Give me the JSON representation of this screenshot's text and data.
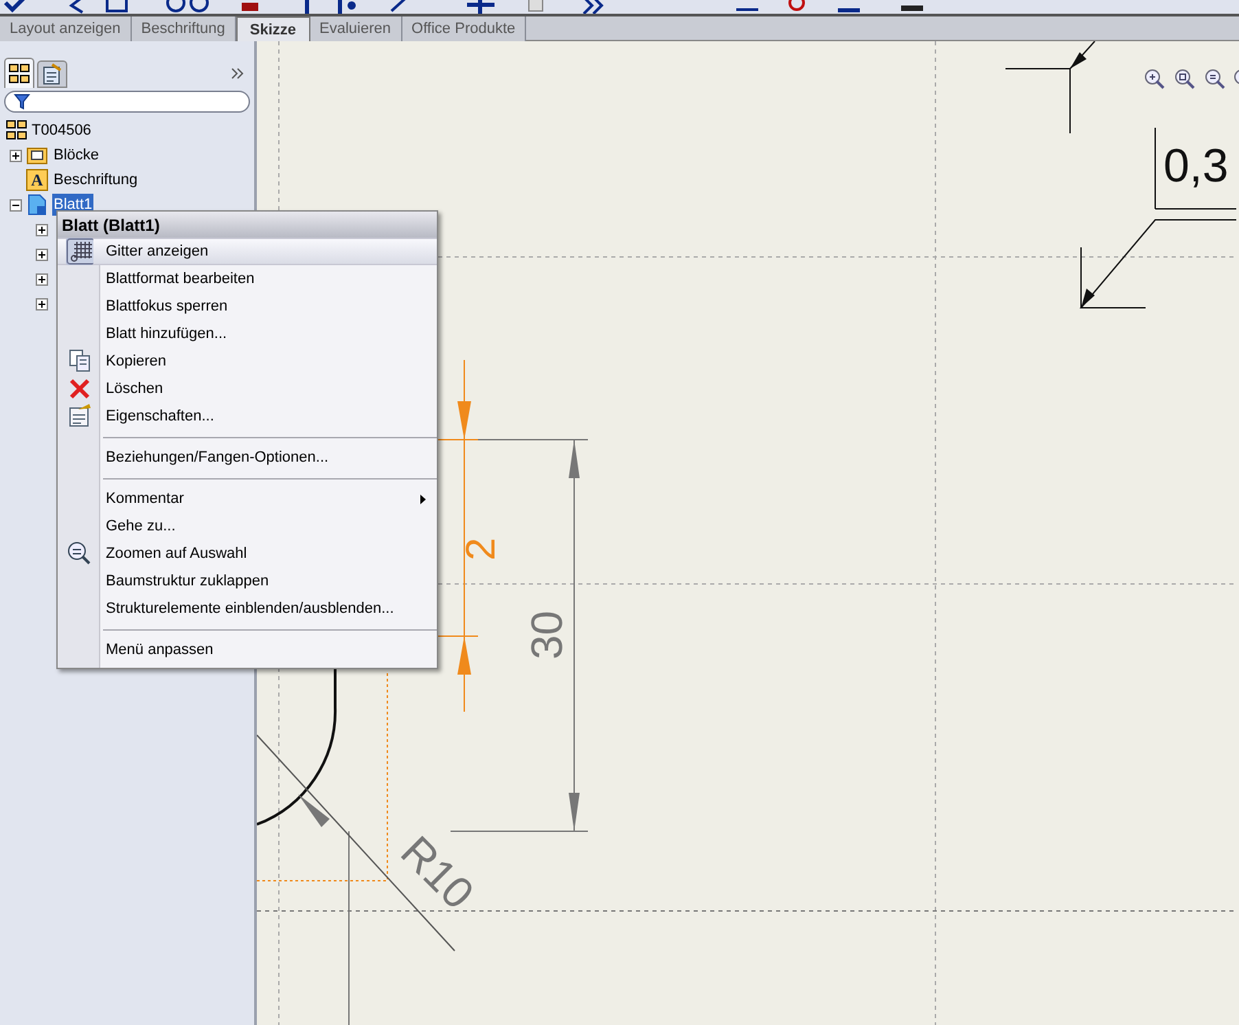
{
  "tabs": [
    {
      "label": "Layout anzeigen",
      "selected": false
    },
    {
      "label": "Beschriftung",
      "selected": false
    },
    {
      "label": "Skizze",
      "selected": true
    },
    {
      "label": "Evaluieren",
      "selected": false
    },
    {
      "label": "Office Produkte",
      "selected": false
    }
  ],
  "panel_tabs": [
    {
      "kind": "tree",
      "selected": true
    },
    {
      "kind": "properties",
      "selected": false
    }
  ],
  "tree": {
    "label": "T004506",
    "children": [
      {
        "label": "Blöcke",
        "expanded": false,
        "selected": false
      },
      {
        "label": "Beschriftung",
        "icon_text": "A",
        "selected": false
      },
      {
        "label": "Blatt1",
        "expanded": true,
        "selected": true,
        "children": [
          {
            "expanded": false
          },
          {
            "expanded": false
          },
          {
            "expanded": false
          },
          {
            "expanded": false
          }
        ]
      }
    ]
  },
  "context_menu": {
    "title": "Blatt (Blatt1)",
    "items": [
      {
        "kind": "item",
        "label": "Gitter anzeigen",
        "selected": true
      },
      {
        "kind": "item",
        "label": "Blattformat bearbeiten",
        "selected": false
      },
      {
        "kind": "item",
        "label": "Blattfokus sperren",
        "selected": false
      },
      {
        "kind": "item",
        "label": "Blatt hinzufügen...",
        "selected": false
      },
      {
        "kind": "item",
        "label": "Kopieren",
        "selected": false
      },
      {
        "kind": "item",
        "label": "Löschen",
        "selected": false
      },
      {
        "kind": "item",
        "label": "Eigenschaften...",
        "selected": false
      },
      {
        "kind": "separator"
      },
      {
        "kind": "item",
        "label": "Beziehungen/Fangen-Optionen...",
        "selected": false
      },
      {
        "kind": "separator"
      },
      {
        "kind": "item",
        "label": "Kommentar",
        "submenu": true,
        "selected": false
      },
      {
        "kind": "item",
        "label": "Gehe zu...",
        "selected": false
      },
      {
        "kind": "item",
        "label": "Zoomen auf Auswahl",
        "selected": false
      },
      {
        "kind": "item",
        "label": "Baumstruktur zuklappen",
        "selected": false
      },
      {
        "kind": "item",
        "label": "Strukturelemente einblenden/ausblenden...",
        "selected": false
      },
      {
        "kind": "separator"
      },
      {
        "kind": "item",
        "label": "Menü anpassen",
        "selected": false
      }
    ]
  },
  "drawing": {
    "labels": [
      "0,3",
      "30",
      "R10",
      "2"
    ]
  }
}
